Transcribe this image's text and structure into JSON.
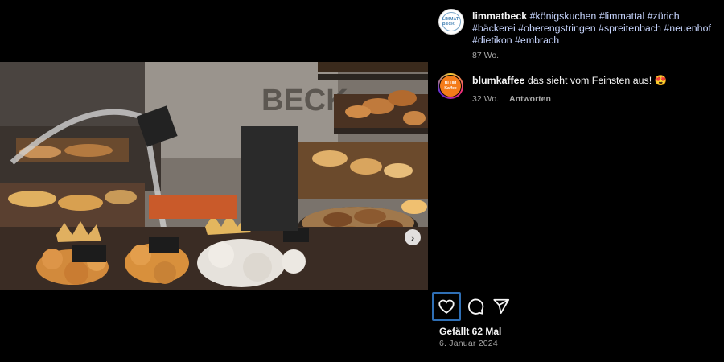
{
  "post": {
    "carousel_next_glyph": "›"
  },
  "comments": [
    {
      "username": "limmatbeck",
      "hashtags_line": "#königskuchen #limmattal #zürich #bäckerei #oberengstringen #spreitenbach #neuenhof #dietikon #embrach",
      "age": "87 Wo.",
      "avatar_text": "LIMMAT BECK"
    },
    {
      "username": "blumkaffee",
      "text": "das sieht vom Feinsten aus! 😍",
      "age": "32 Wo.",
      "reply_label": "Antworten",
      "avatar_text": "BLUM Kaffee"
    }
  ],
  "actions": {
    "like_icon": "heart-outline-icon",
    "comment_icon": "comment-bubble-icon",
    "share_icon": "paper-plane-icon"
  },
  "likes_text": "Gefällt 62 Mal",
  "date_text": "6. Januar 2024",
  "colors": {
    "background": "#000000",
    "hashtag": "#c8d6ff",
    "muted": "#a8a8a8",
    "focus_outline": "#2f6fb5"
  }
}
